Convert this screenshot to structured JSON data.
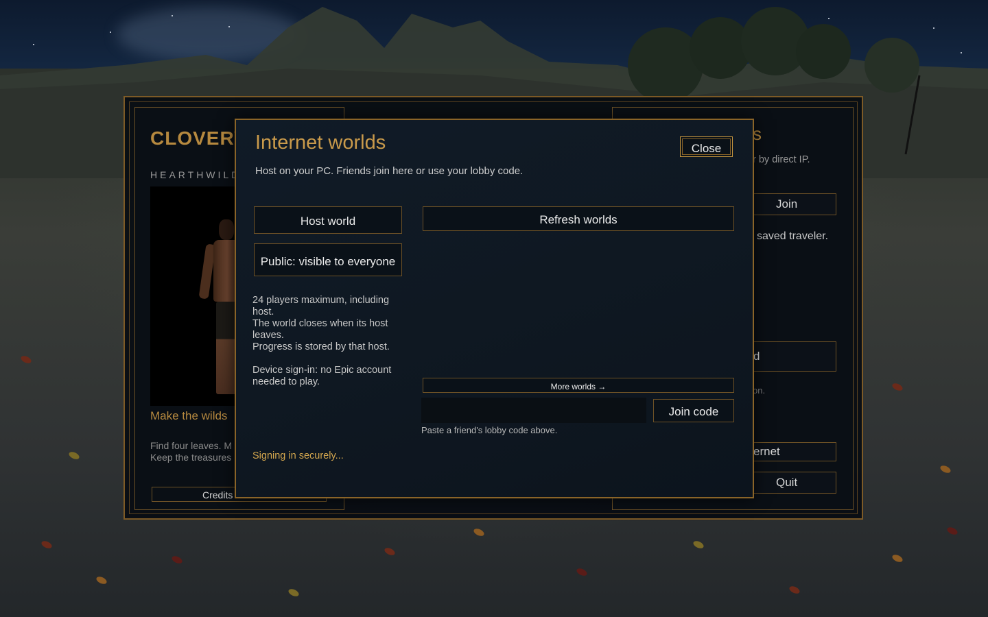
{
  "main_menu": {
    "title": "CLOVERV",
    "subtitle": "HEARTHWILD",
    "tagline": "Make the wilds",
    "description_line1": "Find four leaves. M",
    "description_line2": "Keep the treasures",
    "credits_label": "Credits"
  },
  "right_panel": {
    "heading_fragment": "s",
    "direct_ip_text": "r by direct IP.",
    "join_label": "Join",
    "saved_traveler_text": "saved traveler.",
    "button_fragment": "d",
    "note_fragment": "on.",
    "internet_label": "ernet",
    "quit_label": "Quit"
  },
  "modal": {
    "title": "Internet worlds",
    "subtitle": "Host on your PC. Friends join here or use your lobby code.",
    "close_label": "Close",
    "host_label": "Host world",
    "visibility_label": "Public: visible to everyone",
    "refresh_label": "Refresh worlds",
    "info": {
      "line1": "24 players maximum, including host.",
      "line2": "The world closes when its host leaves.",
      "line3": "Progress is stored by that host.",
      "line4": "Device sign-in: no Epic account needed to play."
    },
    "status": "Signing in securely...",
    "more_worlds_label": "More worlds →",
    "code_input_value": "",
    "code_input_placeholder": "",
    "join_code_label": "Join code",
    "code_hint": "Paste a friend's lobby code above."
  },
  "colors": {
    "accent_gold": "#c99a4b",
    "frame_border": "#8a6428",
    "status_text": "#d3a64e"
  }
}
